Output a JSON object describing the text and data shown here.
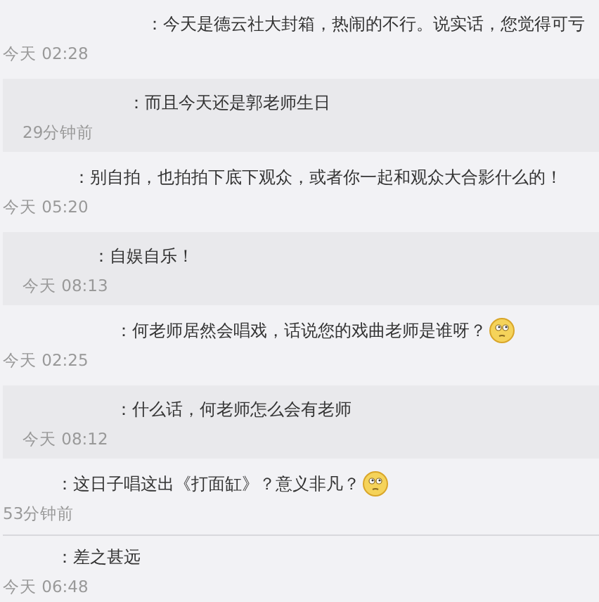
{
  "messages": [
    {
      "kind": "comment",
      "text": "：今天是德云社大封箱，热闹的不行。说实话，您觉得可亏",
      "time": "今天 02:28",
      "emoji": false
    },
    {
      "kind": "reply",
      "text": "：而且今天还是郭老师生日",
      "time": "29分钟前",
      "emoji": false
    },
    {
      "kind": "comment",
      "text": "：别自拍，也拍拍下底下观众，或者你一起和观众大合影什么的！",
      "time": "今天 05:20",
      "emoji": false
    },
    {
      "kind": "reply",
      "text": "：自娱自乐！",
      "time": "今天 08:13",
      "emoji": false
    },
    {
      "kind": "comment",
      "text": "：何老师居然会唱戏，话说您的戏曲老师是谁呀？",
      "time": "今天 02:25",
      "emoji": true
    },
    {
      "kind": "reply",
      "text": "：什么话，何老师怎么会有老师",
      "time": "今天 08:12",
      "emoji": false
    },
    {
      "kind": "comment",
      "text": "：这日子唱这出《打面缸》？意义非凡？",
      "time": "53分钟前",
      "emoji": true
    },
    {
      "kind": "comment",
      "text": "：差之甚远",
      "time": "今天 06:48",
      "emoji": false
    }
  ]
}
